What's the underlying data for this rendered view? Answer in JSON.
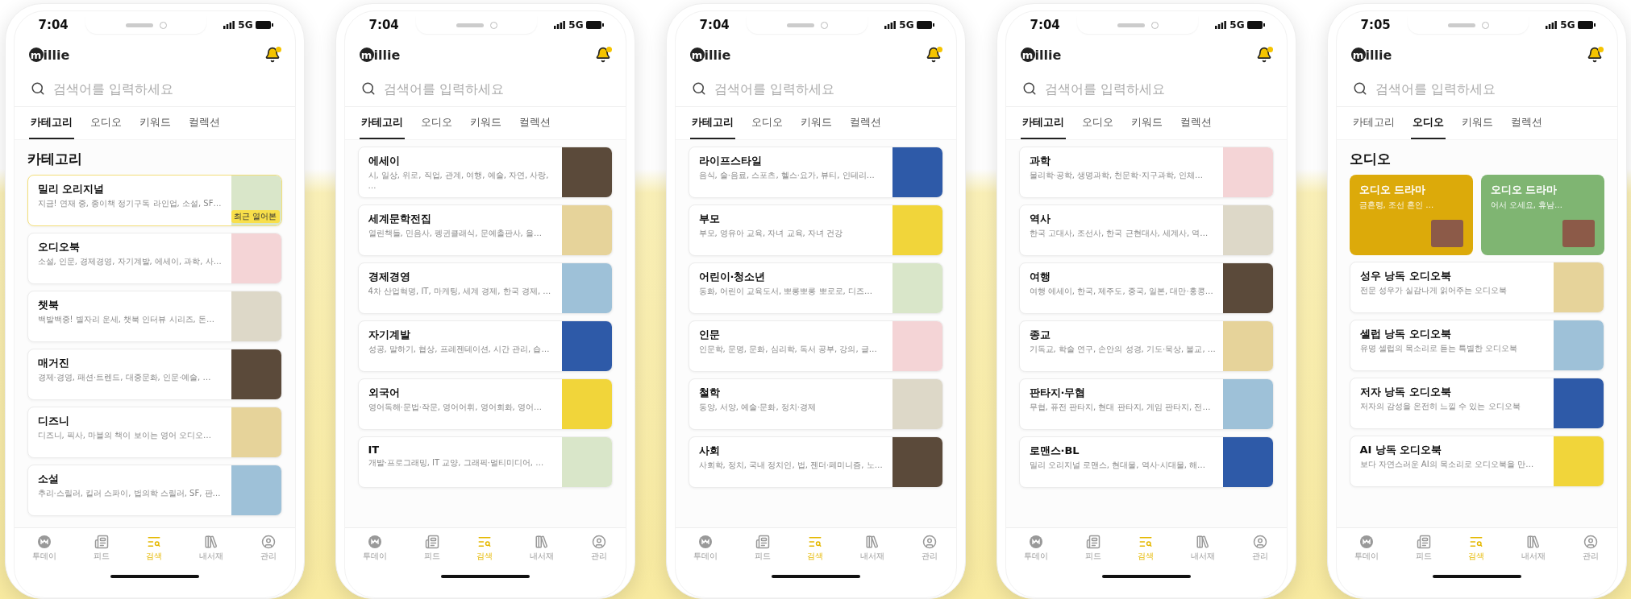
{
  "phones": [
    {
      "status": {
        "time": "7:04",
        "network": "5G"
      },
      "logo": {
        "mark": "m",
        "text": "illie"
      },
      "search": {
        "placeholder": "검색어를 입력하세요"
      },
      "tabs": [
        {
          "label": "카테고리",
          "selected": true
        },
        {
          "label": "오디오",
          "selected": false
        },
        {
          "label": "키워드",
          "selected": false
        },
        {
          "label": "컬렉션",
          "selected": false
        }
      ],
      "section_title": "카테고리",
      "cards": [
        {
          "title": "밀리 오리지널",
          "description": "지금! 연재 중, 종이책 정기구독 라인업, 소설, SF…",
          "badge": "최근 열어본"
        },
        {
          "title": "오디오북",
          "description": "소설, 인문, 경제경영, 자기계발, 에세이, 과학, 사…"
        },
        {
          "title": "챗북",
          "description": "백발백중! 별자리 운세, 챗북 인터뷰 시리즈, 돈…"
        },
        {
          "title": "매거진",
          "description": "경제·경영, 패션·트렌드, 대중문화, 인문·예술, …"
        },
        {
          "title": "디즈니",
          "description": "디즈니, 픽사, 마블의 책이 보이는 영어 오디오…"
        },
        {
          "title": "소설",
          "description": "추리·스릴러, 킬러 스파이, 법의학 스릴러, SF, 판…"
        }
      ],
      "nav": [
        {
          "kind": "today",
          "label": "투데이",
          "selected": false
        },
        {
          "kind": "feed",
          "label": "피드",
          "selected": false
        },
        {
          "kind": "search",
          "label": "검색",
          "selected": true
        },
        {
          "kind": "library",
          "label": "내서재",
          "selected": false
        },
        {
          "kind": "account",
          "label": "관리",
          "selected": false
        }
      ]
    },
    {
      "status": {
        "time": "7:04",
        "network": "5G"
      },
      "logo": {
        "mark": "m",
        "text": "illie"
      },
      "search": {
        "placeholder": "검색어를 입력하세요"
      },
      "tabs": [
        {
          "label": "카테고리",
          "selected": true
        },
        {
          "label": "오디오",
          "selected": false
        },
        {
          "label": "키워드",
          "selected": false
        },
        {
          "label": "컬렉션",
          "selected": false
        }
      ],
      "cards": [
        {
          "title": "에세이",
          "description": "시, 일상, 위로, 직업, 관계, 여행, 예술, 자연, 사랑, …"
        },
        {
          "title": "세계문학전집",
          "description": "열린책들, 민음사, 펭귄클래식, 문예출판사, 을…"
        },
        {
          "title": "경제경영",
          "description": "4차 산업혁명, IT, 마케팅, 세계 경제, 한국 경제, …"
        },
        {
          "title": "자기계발",
          "description": "성공, 말하기, 협상, 프레젠테이션, 시간 관리, 습…"
        },
        {
          "title": "외국어",
          "description": "영어독해·문법·작문, 영어어휘, 영어회화, 영어…"
        },
        {
          "title": "IT",
          "description": "개발·프로그래밍, IT 교양, 그래픽·멀티미디어, …"
        }
      ],
      "nav": [
        {
          "kind": "today",
          "label": "투데이",
          "selected": false
        },
        {
          "kind": "feed",
          "label": "피드",
          "selected": false
        },
        {
          "kind": "search",
          "label": "검색",
          "selected": true
        },
        {
          "kind": "library",
          "label": "내서재",
          "selected": false
        },
        {
          "kind": "account",
          "label": "관리",
          "selected": false
        }
      ]
    },
    {
      "status": {
        "time": "7:04",
        "network": "5G"
      },
      "logo": {
        "mark": "m",
        "text": "illie"
      },
      "search": {
        "placeholder": "검색어를 입력하세요"
      },
      "tabs": [
        {
          "label": "카테고리",
          "selected": true
        },
        {
          "label": "오디오",
          "selected": false
        },
        {
          "label": "키워드",
          "selected": false
        },
        {
          "label": "컬렉션",
          "selected": false
        }
      ],
      "cards": [
        {
          "title": "라이프스타일",
          "description": "음식, 술·음료, 스포츠, 헬스·요가, 뷰티, 인테리…"
        },
        {
          "title": "부모",
          "description": "부모, 영유아 교육, 자녀 교육, 자녀 건강"
        },
        {
          "title": "어린이·청소년",
          "description": "동화, 어린이 교육도서, 뽀롱뽀롱 뽀로로, 디즈…"
        },
        {
          "title": "인문",
          "description": "인문학, 문명, 문화, 심리학, 독서 공부, 강의, 글…"
        },
        {
          "title": "철학",
          "description": "동양, 서양, 예술·문화, 정치·경제"
        },
        {
          "title": "사회",
          "description": "사회학, 정치, 국내 정치인, 법, 젠더·페미니즘, 노…"
        }
      ],
      "nav": [
        {
          "kind": "today",
          "label": "투데이",
          "selected": false
        },
        {
          "kind": "feed",
          "label": "피드",
          "selected": false
        },
        {
          "kind": "search",
          "label": "검색",
          "selected": true
        },
        {
          "kind": "library",
          "label": "내서재",
          "selected": false
        },
        {
          "kind": "account",
          "label": "관리",
          "selected": false
        }
      ]
    },
    {
      "status": {
        "time": "7:04",
        "network": "5G"
      },
      "logo": {
        "mark": "m",
        "text": "illie"
      },
      "search": {
        "placeholder": "검색어를 입력하세요"
      },
      "tabs": [
        {
          "label": "카테고리",
          "selected": true
        },
        {
          "label": "오디오",
          "selected": false
        },
        {
          "label": "키워드",
          "selected": false
        },
        {
          "label": "컬렉션",
          "selected": false
        }
      ],
      "cards": [
        {
          "title": "과학",
          "description": "물리학·공학, 생명과학, 천문학·지구과학, 인체…"
        },
        {
          "title": "역사",
          "description": "한국 고대사, 조선사, 한국 근현대사, 세계사, 역…"
        },
        {
          "title": "여행",
          "description": "여행 에세이, 한국, 제주도, 중국, 일본, 대만·홍콩…"
        },
        {
          "title": "종교",
          "description": "기독교, 학술 연구, 손안의 성경, 기도·묵상, 불교, …"
        },
        {
          "title": "판타지·무협",
          "description": "무협, 퓨전 판타지, 현대 판타지, 게임 판타지, 전…"
        },
        {
          "title": "로맨스·BL",
          "description": "밀리 오리지널 로맨스, 현대물, 역사·시대물, 해…"
        }
      ],
      "nav": [
        {
          "kind": "today",
          "label": "투데이",
          "selected": false
        },
        {
          "kind": "feed",
          "label": "피드",
          "selected": false
        },
        {
          "kind": "search",
          "label": "검색",
          "selected": true
        },
        {
          "kind": "library",
          "label": "내서재",
          "selected": false
        },
        {
          "kind": "account",
          "label": "관리",
          "selected": false
        }
      ]
    },
    {
      "status": {
        "time": "7:05",
        "network": "5G"
      },
      "logo": {
        "mark": "m",
        "text": "illie"
      },
      "search": {
        "placeholder": "검색어를 입력하세요"
      },
      "tabs": [
        {
          "label": "카테고리",
          "selected": false
        },
        {
          "label": "오디오",
          "selected": true
        },
        {
          "label": "키워드",
          "selected": false
        },
        {
          "label": "컬렉션",
          "selected": false
        }
      ],
      "section_title": "오디오",
      "tiles": [
        {
          "title": "오디오 드라마",
          "description": "금혼령, 조선 혼인 …",
          "color": "#dcaa0a"
        },
        {
          "title": "오디오 드라마",
          "description": "어서 오세요, 휴남…",
          "color": "#7fb572"
        }
      ],
      "cards": [
        {
          "title": "성우 낭독 오디오북",
          "description": "전문 성우가 실감나게 읽어주는 오디오북"
        },
        {
          "title": "셀럽 낭독 오디오북",
          "description": "유명 셀럽의 목소리로 듣는 특별한 오디오북"
        },
        {
          "title": "저자 낭독 오디오북",
          "description": "저자의 감성을 온전히 느낄 수 있는 오디오북"
        },
        {
          "title": "AI 낭독 오디오북",
          "description": "보다 자연스러운 AI의 목소리로 오디오북을 만…"
        }
      ],
      "nav": [
        {
          "kind": "today",
          "label": "투데이",
          "selected": false
        },
        {
          "kind": "feed",
          "label": "피드",
          "selected": false
        },
        {
          "kind": "search",
          "label": "검색",
          "selected": true
        },
        {
          "kind": "library",
          "label": "내서재",
          "selected": false
        },
        {
          "kind": "account",
          "label": "관리",
          "selected": false
        }
      ]
    }
  ]
}
